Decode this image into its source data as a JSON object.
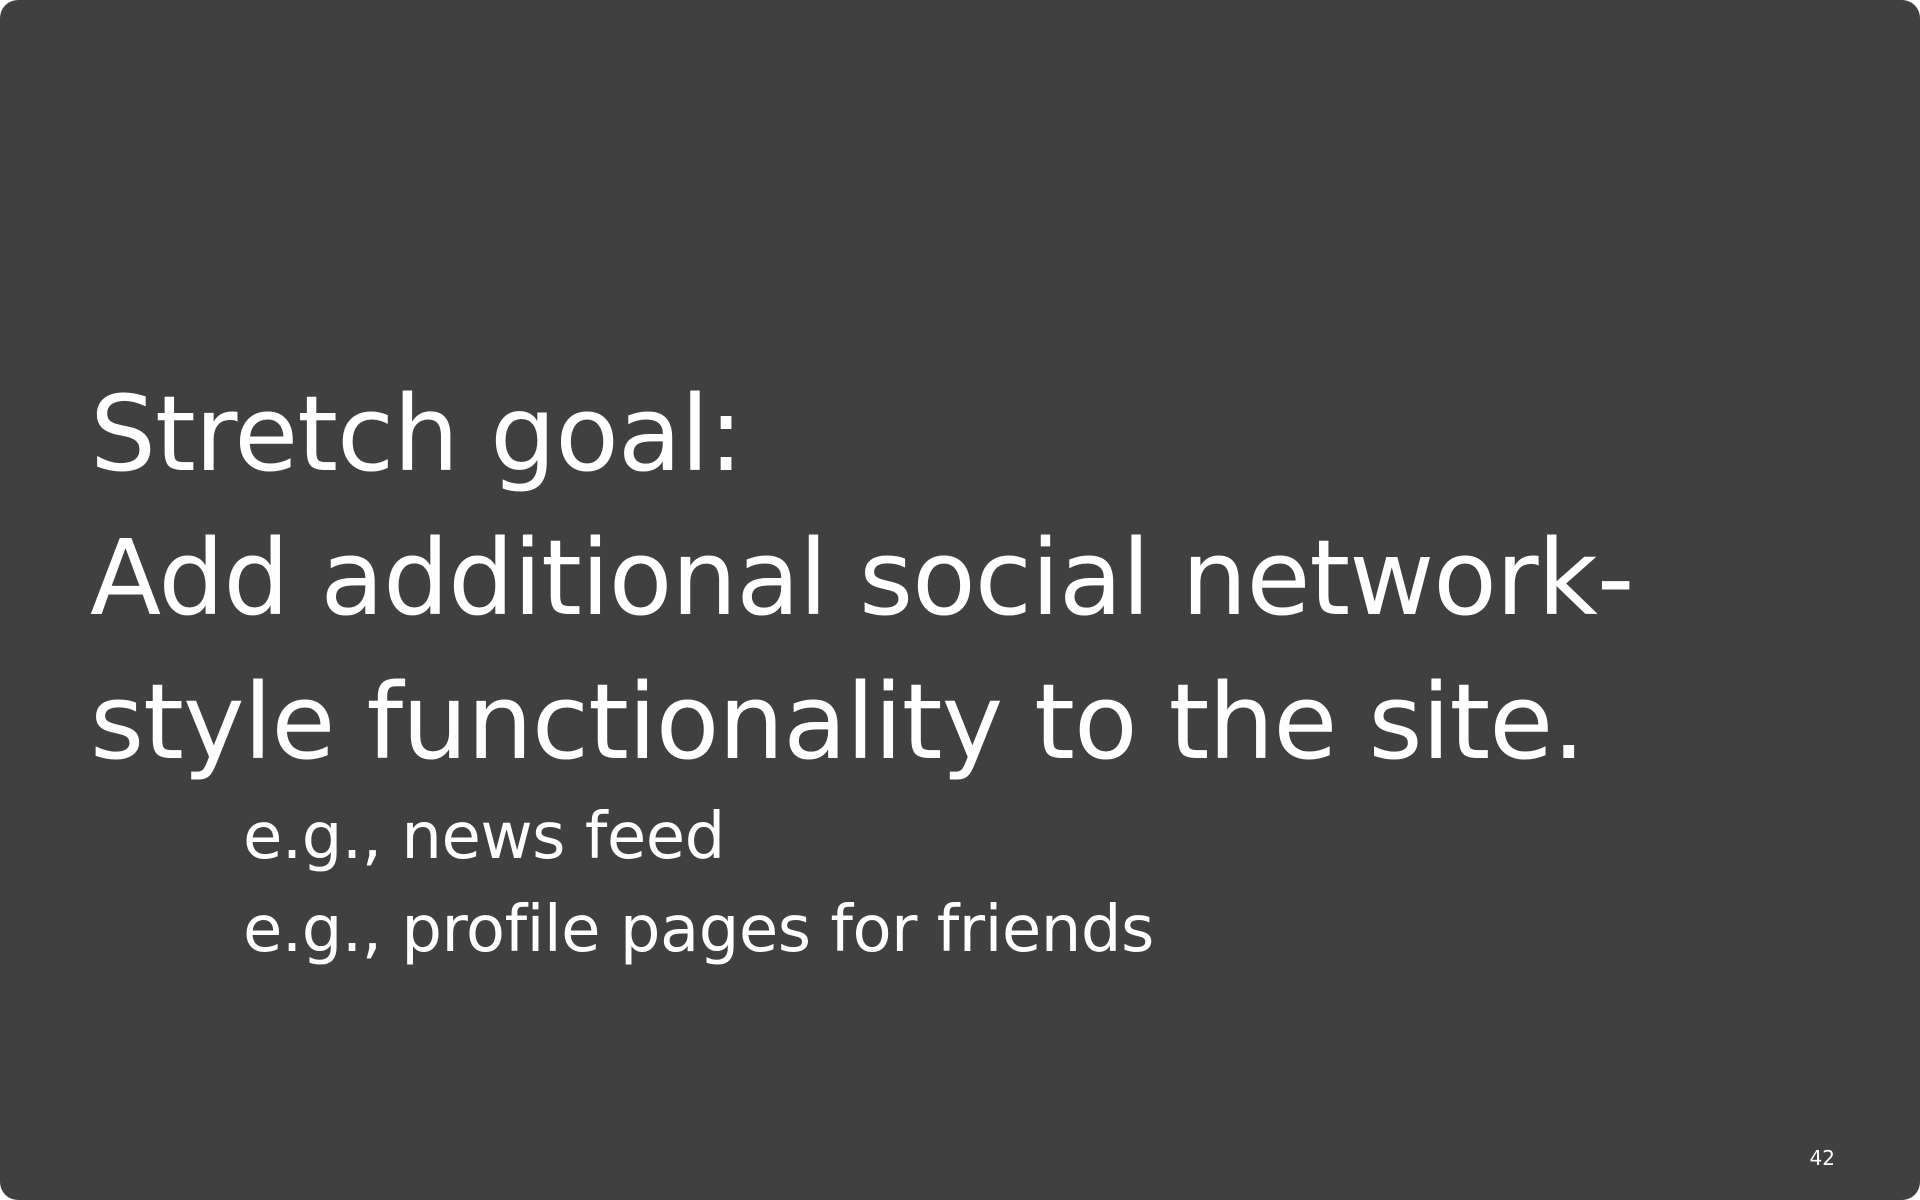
{
  "slide": {
    "background_color": "#404040",
    "text_color": "#ffffff",
    "heading_lines": [
      "Stretch goal:",
      "Add additional social network-",
      "style functionality to the site."
    ],
    "examples": [
      "e.g., news feed",
      "e.g., profile pages for friends"
    ],
    "page_number": "42"
  }
}
